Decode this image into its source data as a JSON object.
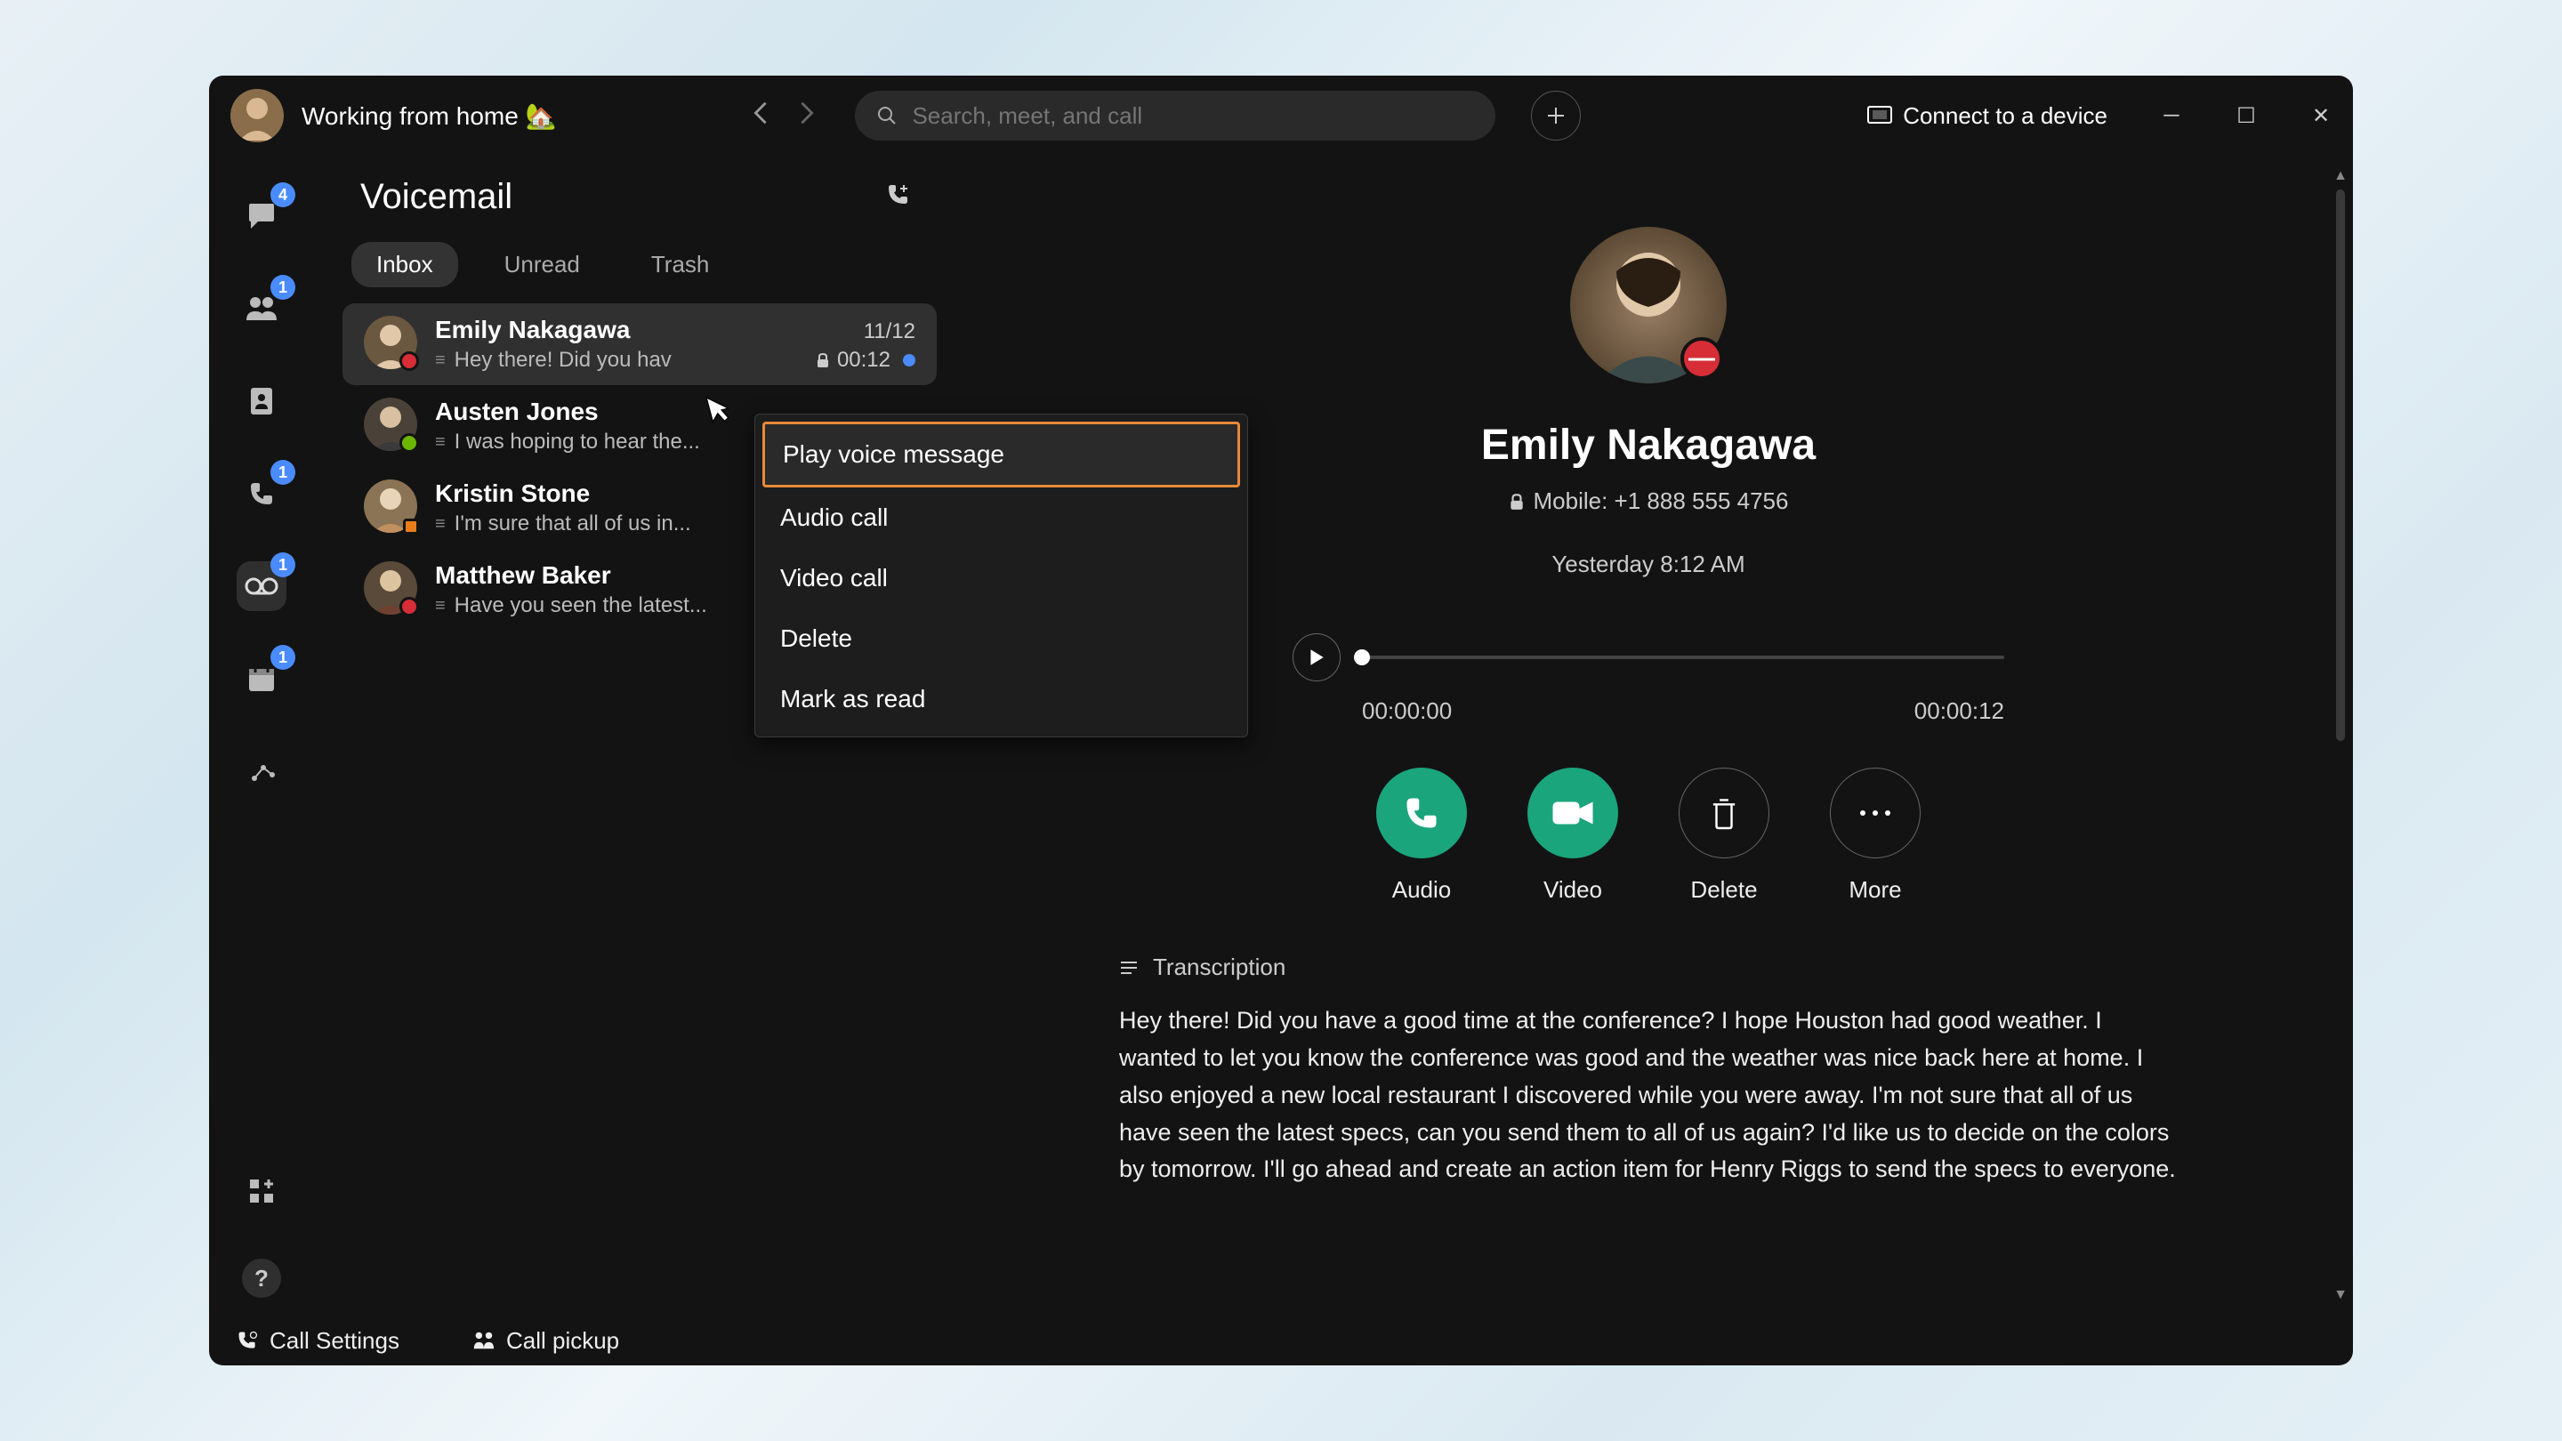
{
  "titleBar": {
    "status": "Working from home 🏡",
    "searchPlaceholder": "Search, meet, and call",
    "connectDevice": "Connect to a device"
  },
  "rail": {
    "badges": {
      "chat": "4",
      "teams": "1",
      "calls": "1",
      "voicemail": "1",
      "calendar": "1"
    }
  },
  "listPanel": {
    "title": "Voicemail",
    "tabs": {
      "inbox": "Inbox",
      "unread": "Unread",
      "trash": "Trash"
    },
    "items": [
      {
        "name": "Emily Nakagawa",
        "preview": "Hey there! Did you hav",
        "date": "11/12",
        "duration": "00:12",
        "selected": true,
        "unread": true,
        "presence": "dnd"
      },
      {
        "name": "Austen Jones",
        "preview": "I was hoping to hear the...",
        "presence": "available"
      },
      {
        "name": "Kristin Stone",
        "preview": "I'm sure that all of us in...",
        "presence": "busy"
      },
      {
        "name": "Matthew Baker",
        "preview": "Have you seen the latest...",
        "presence": "dnd"
      }
    ]
  },
  "contextMenu": {
    "play": "Play voice message",
    "audio": "Audio call",
    "video": "Video call",
    "delete": "Delete",
    "markRead": "Mark as read"
  },
  "detail": {
    "name": "Emily Nakagawa",
    "phoneLabel": "Mobile: +1 888 555 4756",
    "timestamp": "Yesterday 8:12 AM",
    "elapsed": "00:00:00",
    "total": "00:00:12",
    "actions": {
      "audio": "Audio",
      "video": "Video",
      "delete": "Delete",
      "more": "More"
    },
    "transcriptionHeader": "Transcription",
    "transcription": "Hey there! Did you have a good time at the conference? I hope Houston had good weather. I wanted to let you know the conference was good and the weather was nice back here at home. I also enjoyed a new local restaurant I discovered while you were away. I'm not sure that all of us have seen the latest specs, can you send them to all of us again? I'd like us to decide on the colors by tomorrow. I'll go ahead and create an action item for Henry Riggs to send the specs to everyone."
  },
  "footer": {
    "callSettings": "Call Settings",
    "callPickup": "Call pickup"
  }
}
